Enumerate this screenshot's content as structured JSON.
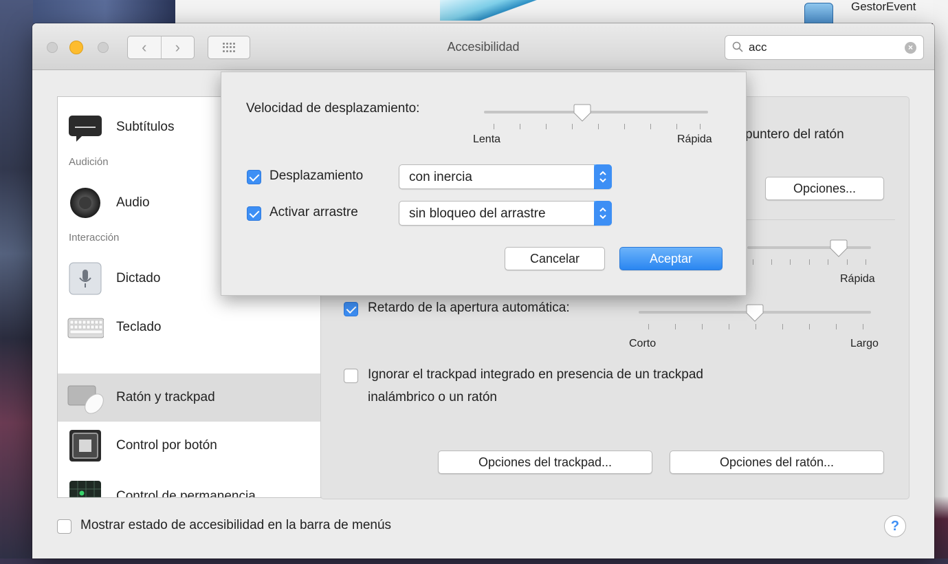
{
  "desktop": {
    "icon_label": "GestorEvent"
  },
  "window": {
    "title": "Accesibilidad"
  },
  "toolbar": {
    "back": "‹",
    "forward": "›"
  },
  "search": {
    "value": "acc",
    "clear": "×"
  },
  "sidebar": {
    "items": [
      {
        "label": "Subtítulos",
        "icon": "subtitles-icon"
      },
      {
        "header": "Audición"
      },
      {
        "label": "Audio",
        "icon": "speaker-icon"
      },
      {
        "header": "Interacción"
      },
      {
        "label": "Dictado",
        "icon": "microphone-icon"
      },
      {
        "label": "Teclado",
        "icon": "keyboard-icon"
      },
      {
        "label": "Ratón y trackpad",
        "icon": "mouse-trackpad-icon",
        "selected": true
      },
      {
        "label": "Control por botón",
        "icon": "switch-control-icon"
      },
      {
        "label": "Control de permanencia",
        "icon": "dwell-control-icon"
      }
    ]
  },
  "pane": {
    "pointer_text_partial": "puntero del ratón",
    "options_button": "Opciones...",
    "speed_right_label": "Rápida",
    "speed_level": 0.74,
    "spring_loading_label": "Retardo de la apertura automática:",
    "spring_loading_checked": true,
    "spring_min": "Corto",
    "spring_max": "Largo",
    "spring_level": 0.5,
    "ignore_trackpad_label_line1": "Ignorar el trackpad integrado en presencia de un trackpad",
    "ignore_trackpad_label_line2": "inalámbrico o un ratón",
    "ignore_trackpad_checked": false,
    "trackpad_options_button": "Opciones del trackpad...",
    "mouse_options_button": "Opciones del ratón..."
  },
  "sheet": {
    "scroll_speed_label": "Velocidad de desplazamiento:",
    "scroll_speed_min": "Lenta",
    "scroll_speed_max": "Rápida",
    "scroll_speed_level": 0.44,
    "scrolling_label": "Desplazamiento",
    "scrolling_checked": true,
    "scrolling_value": "con inercia",
    "dragging_label": "Activar arrastre",
    "dragging_checked": true,
    "dragging_value": "sin bloqueo del arrastre",
    "cancel_button": "Cancelar",
    "ok_button": "Aceptar"
  },
  "footer": {
    "menu_status_label": "Mostrar estado de accesibilidad en la barra de menús",
    "menu_status_checked": false,
    "help": "?"
  },
  "colors": {
    "accent": "#3d8ff5",
    "selected_row": "#dcdcdc",
    "window_bg": "#ececec"
  }
}
